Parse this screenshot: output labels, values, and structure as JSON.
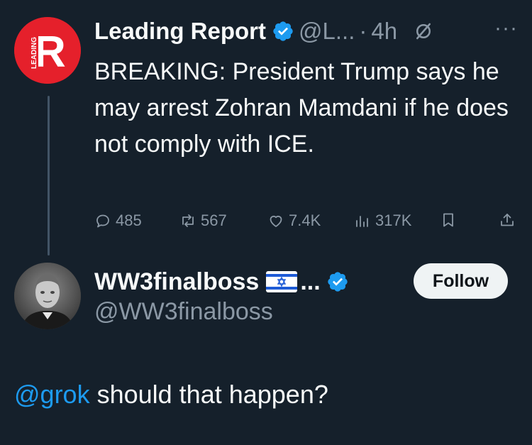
{
  "colors": {
    "background": "#15202b",
    "text_primary": "#f7f9f9",
    "text_secondary": "#8b98a5",
    "accent": "#1d9bf0",
    "leading_red": "#e5202b",
    "follow_bg": "#eff3f4"
  },
  "tweet": {
    "author_name": "Leading Report",
    "handle": "@L...",
    "separator": "·",
    "time": "4h",
    "more": "···",
    "avatar_letter": "R",
    "avatar_label": "LEADING",
    "body": "BREAKING: President Trump says he may arrest Zohran Mamdani if he does not comply with ICE.",
    "stats": {
      "replies": "485",
      "reposts": "567",
      "likes": "7.4K",
      "views": "317K"
    },
    "icons": {
      "verified": "verified-badge-icon",
      "grok": "grok-icon",
      "more": "more-icon",
      "reply": "reply-icon",
      "repost": "repost-icon",
      "like": "like-icon",
      "views": "views-icon",
      "bookmark": "bookmark-icon",
      "share": "share-icon"
    }
  },
  "reply": {
    "author_name": "WW3finalboss",
    "name_suffix": "...",
    "handle": "@WW3finalboss",
    "follow_label": "Follow",
    "mention": "@grok",
    "text": " should that happen?",
    "icons": {
      "flag": "israel-flag-icon",
      "verified": "verified-badge-icon"
    }
  }
}
